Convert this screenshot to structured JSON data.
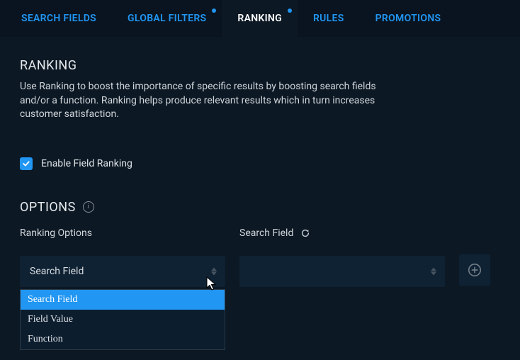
{
  "tabs": {
    "search_fields": "SEARCH FIELDS",
    "global_filters": "GLOBAL FILTERS",
    "ranking": "RANKING",
    "rules": "RULES",
    "promotions": "PROMOTIONS"
  },
  "ranking": {
    "heading": "RANKING",
    "description": "Use Ranking to boost the importance of specific results by boosting search fields and/or a function. Ranking helps produce relevant results which in turn increases customer satisfaction.",
    "enable_label": "Enable Field Ranking",
    "enable_checked": true
  },
  "options": {
    "heading": "OPTIONS",
    "ranking_options_label": "Ranking Options",
    "search_field_label": "Search Field",
    "ranking_options_value": "Search Field",
    "search_field_value": "",
    "dropdown": [
      "Search Field",
      "Field Value",
      "Function"
    ],
    "dropdown_highlight_index": 0
  },
  "icons": {
    "info": "i"
  }
}
